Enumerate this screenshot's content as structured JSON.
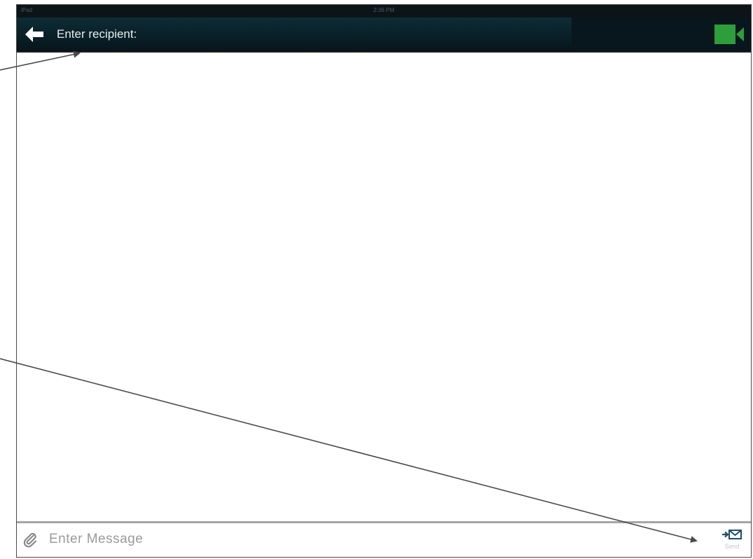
{
  "status_bar": {
    "carrier": "iPad",
    "time": "2:36 PM"
  },
  "header": {
    "back_icon": "back-arrow-icon",
    "recipient_placeholder": "Enter recipient:",
    "video_icon": "video-camera-icon"
  },
  "compose": {
    "attach_icon": "paperclip-icon",
    "message_placeholder": "Enter Message",
    "send_icon": "send-mail-icon",
    "send_label": "Send"
  },
  "colors": {
    "nav_background": "#0a2028",
    "video_icon": "#2e9e3a",
    "divider": "#a5a5a5",
    "placeholder_text": "#9a9a9a"
  }
}
